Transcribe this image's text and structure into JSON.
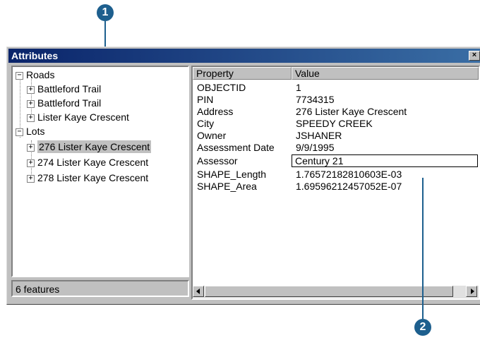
{
  "callouts": {
    "one": "1",
    "two": "2"
  },
  "window": {
    "title": "Attributes",
    "close_glyph": "×"
  },
  "tree": {
    "groups": [
      {
        "label": "Roads",
        "expander": "−",
        "children": [
          "Battleford Trail",
          "Battleford Trail",
          "Lister Kaye Crescent"
        ]
      },
      {
        "label": "Lots",
        "expander": "−",
        "children": [
          "276 Lister Kaye Crescent",
          "274 Lister Kaye Crescent",
          "278 Lister Kaye Crescent"
        ]
      }
    ],
    "child_expander": "+",
    "selected": "276 Lister Kaye Crescent"
  },
  "status": {
    "text": "6 features"
  },
  "grid": {
    "headers": {
      "property": "Property",
      "value": "Value"
    },
    "rows": [
      {
        "property": "OBJECTID",
        "value": "1"
      },
      {
        "property": "PIN",
        "value": "7734315"
      },
      {
        "property": "Address",
        "value": "276 Lister Kaye Crescent"
      },
      {
        "property": "City",
        "value": "SPEEDY CREEK"
      },
      {
        "property": "Owner",
        "value": "JSHANER"
      },
      {
        "property": "Assessment Date",
        "value": "9/9/1995"
      },
      {
        "property": "Assessor",
        "value": "Century 21"
      },
      {
        "property": "SHAPE_Length",
        "value": "1.76572182810603E-03"
      },
      {
        "property": "SHAPE_Area",
        "value": "1.69596212457052E-07"
      }
    ]
  },
  "colors": {
    "title_bar": "#0a246a",
    "callout": "#1d5f8e",
    "selected_bg": "#c0c0c0"
  }
}
